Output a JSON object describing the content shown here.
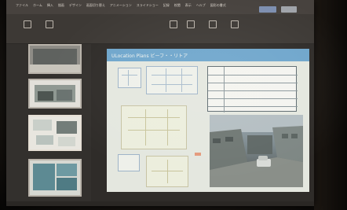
{
  "app": {
    "menu": [
      "ファイル",
      "ホーム",
      "挿入",
      "描画",
      "デザイン",
      "画面切り替え",
      "アニメーション",
      "スライドショー",
      "記録",
      "校閲",
      "表示",
      "ヘルプ",
      "図形の書式"
    ],
    "share_label": "",
    "comment_label": ""
  },
  "ribbon": {
    "tools": [
      "",
      "",
      "",
      "",
      ""
    ]
  },
  "thumbnails": [
    {
      "num": ""
    },
    {
      "num": ""
    },
    {
      "num": ""
    },
    {
      "num": ""
    }
  ],
  "slide": {
    "title": "ULocation Plans ビーフ・・リトア",
    "header_color": "#6fa6cc",
    "table_rows": [
      "",
      "",
      "",
      "",
      ""
    ]
  },
  "status": {
    "text": ""
  }
}
